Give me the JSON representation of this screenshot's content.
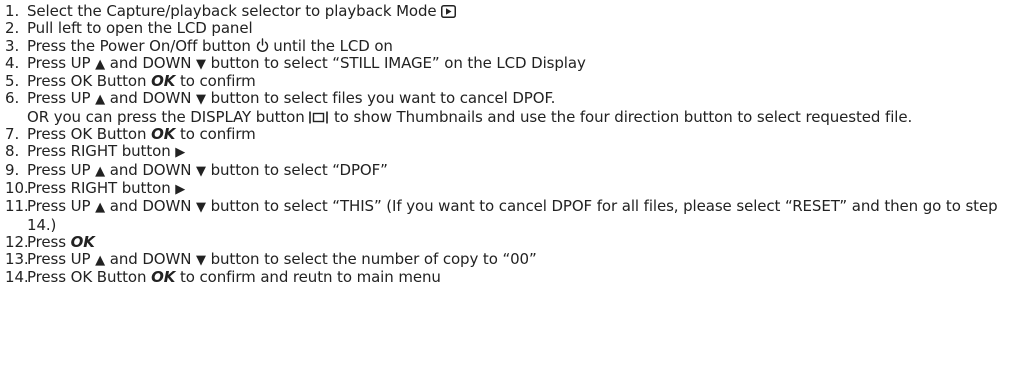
{
  "steps": [
    {
      "num": "1.",
      "text": "Select the Capture/playback selector to playback Mode",
      "icon": "playback-mode-icon"
    },
    {
      "num": "2.",
      "text": "Pull left to open the LCD panel"
    },
    {
      "num": "3.",
      "a": "Press the Power On/Off button",
      "b": "until the LCD on",
      "icon": "power-icon"
    },
    {
      "num": "4.",
      "a": "Press UP",
      "b": "and DOWN",
      "c": "button to select “STILL IMAGE” on the LCD Display"
    },
    {
      "num": "5.",
      "a": "Press OK Button",
      "ok": "OK",
      "b": "to confirm"
    },
    {
      "num": "6.",
      "a": "Press UP",
      "b": "and DOWN",
      "c": "button to select files you want to cancel DPOF.",
      "d": "OR you can press the DISPLAY button",
      "e": "to show Thumbnails and use the four direction button to select requested file.",
      "icon": "display-button-icon"
    },
    {
      "num": "7.",
      "a": "Press OK Button",
      "ok": "OK",
      "b": "to confirm"
    },
    {
      "num": "8.",
      "text": "Press RIGHT button"
    },
    {
      "num": "9.",
      "a": "Press UP",
      "b": "and DOWN",
      "c": "button to select “DPOF”"
    },
    {
      "num": "10.",
      "text": "Press RIGHT button"
    },
    {
      "num": "11.",
      "a": "Press UP",
      "b": "and DOWN",
      "c": "button to select “THIS” (If you want to cancel DPOF for all files, please select “RESET” and then go to step 14.)"
    },
    {
      "num": "12.",
      "a": "Press",
      "ok": "OK"
    },
    {
      "num": "13.",
      "a": "Press UP",
      "b": "and DOWN",
      "c": "button to select the number of copy to “00”"
    },
    {
      "num": "14.",
      "a": "Press OK Button",
      "ok": "OK",
      "b": "to confirm and reutn to main menu"
    }
  ],
  "glyphs": {
    "up": "▲",
    "down": "▼",
    "right": "▶"
  },
  "colors": {
    "text": "#222222",
    "background": "#ffffff"
  }
}
